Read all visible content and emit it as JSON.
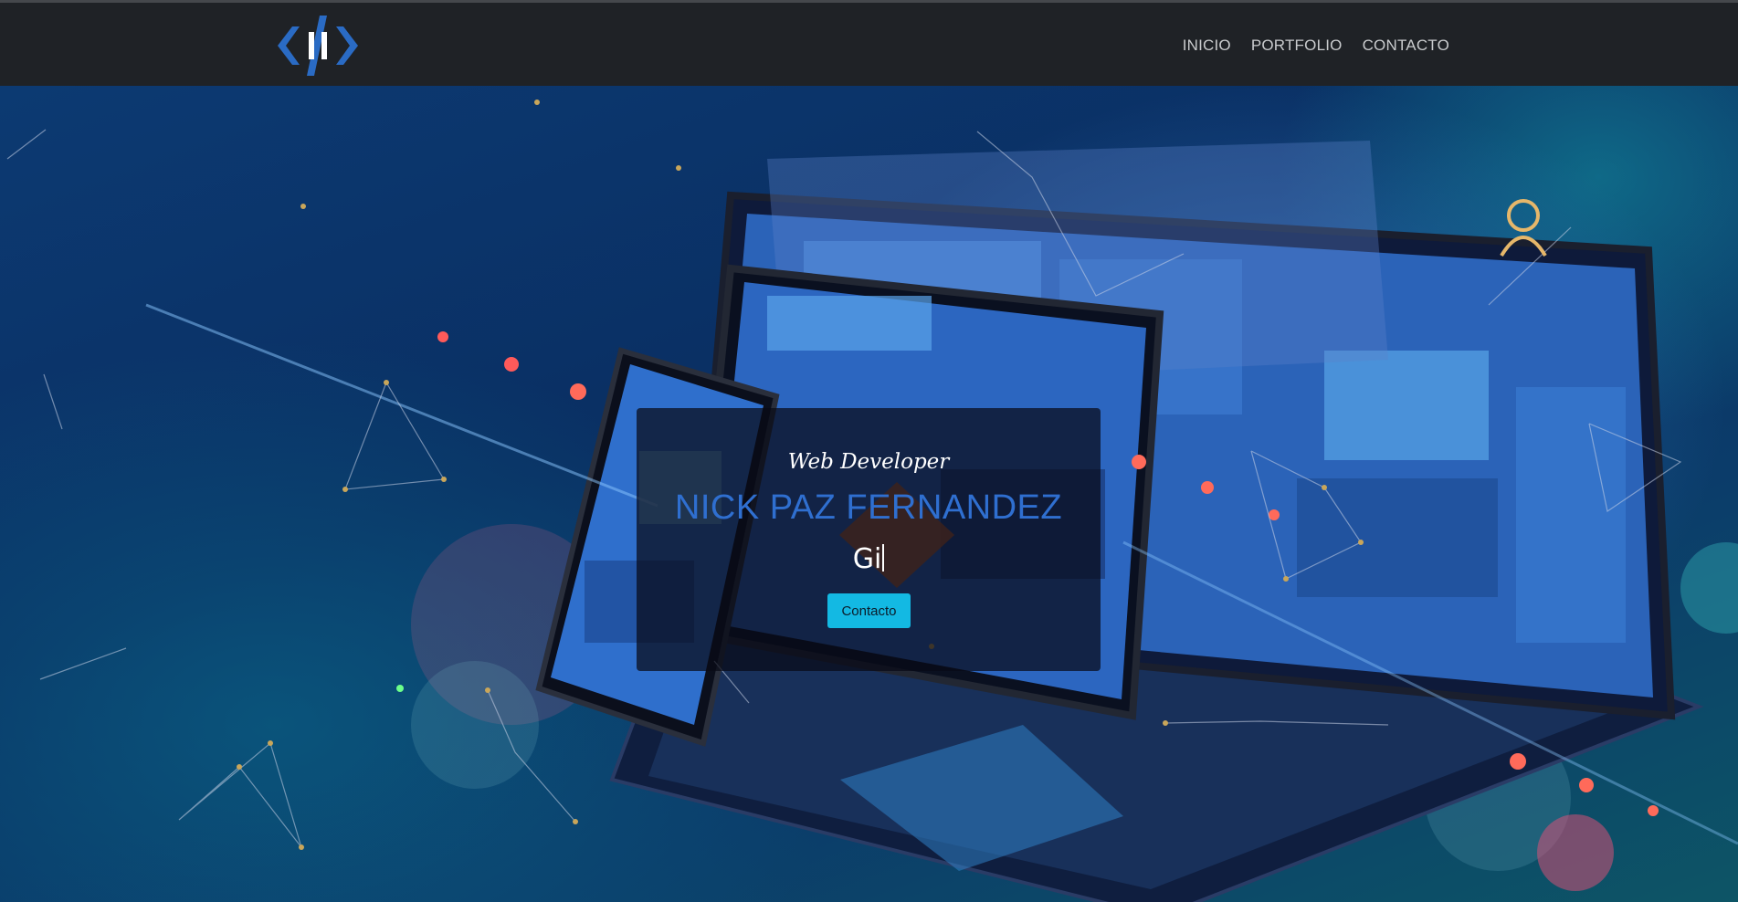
{
  "nav": {
    "links": [
      "INICIO",
      "PORTFOLIO",
      "CONTACTO"
    ]
  },
  "hero": {
    "subtitle": "Web Developer",
    "name": "NICK PAZ FERNANDEZ",
    "typed_text": "Gi",
    "button_label": "Contacto"
  },
  "colors": {
    "navbar": "#1f2226",
    "accent_button": "#13b9e3",
    "name_blue": "#2f6fd0",
    "logo_blue": "#2a6bc4"
  },
  "icons": [
    "code-logo-icon"
  ]
}
